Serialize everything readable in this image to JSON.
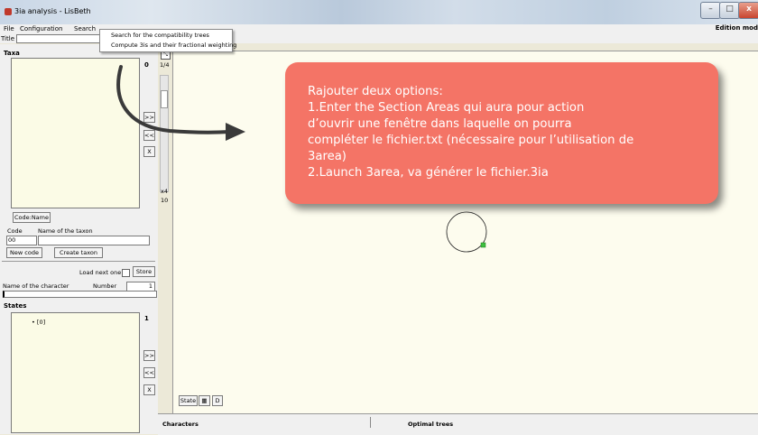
{
  "window": {
    "title": "3ia analysis - LisBeth",
    "controls": {
      "minimize": "–",
      "maximize": "□",
      "close": "x"
    }
  },
  "menubar": {
    "items": [
      "File",
      "Configuration",
      "Search"
    ],
    "mode": "Edition mod"
  },
  "title_row": {
    "label": "Title :",
    "value": ""
  },
  "dropdown": {
    "items": [
      "Search for the compatibility trees",
      "Compute 3is and their fractional weighting"
    ]
  },
  "taxa": {
    "label": "Taxa",
    "count": "0",
    "fraction": "1/4",
    "move_right": ">>",
    "move_left": "<<",
    "remove": "X",
    "zoom_level": "x4",
    "zoom_value": "10",
    "code_name_button": "Code:Name",
    "code_header": "Code",
    "name_header": "Name of the taxon",
    "code_value": "00",
    "name_value": "",
    "new_code_button": "New code",
    "create_taxon_button": "Create taxon"
  },
  "character": {
    "load_next_label": "Load next one",
    "load_next_checked": false,
    "store_button": "Store",
    "name_label": "Name of the character",
    "number_label": "Number",
    "number_value": "1",
    "name_value": ""
  },
  "states": {
    "label": "States",
    "count": "1",
    "items": [
      "[0]"
    ],
    "move_right": ">>",
    "move_left": "<<",
    "remove": "X"
  },
  "canvas_toolbar": {
    "state_button": "State",
    "icon_button": "grid-icon",
    "d_button": "D"
  },
  "bottom_bar": {
    "characters_label": "Characters",
    "optimal_trees_label": "Optimal trees"
  },
  "annotation": {
    "lines": [
      "Rajouter deux options:",
      "1.Enter the Section Areas qui aura pour action",
      "d’ouvrir une fenêtre dans laquelle on pourra",
      "compléter le fichier.txt (nécessaire pour l’utilisation de",
      "3area)",
      "2.Launch 3area, va générer le fichier.3ia"
    ],
    "color": "#f47466"
  },
  "colors": {
    "canvas_bg": "#fdfcee",
    "list_bg": "#fbfbe6",
    "arrow": "#3a3a3a",
    "node_handle": "#3fbf3f"
  }
}
